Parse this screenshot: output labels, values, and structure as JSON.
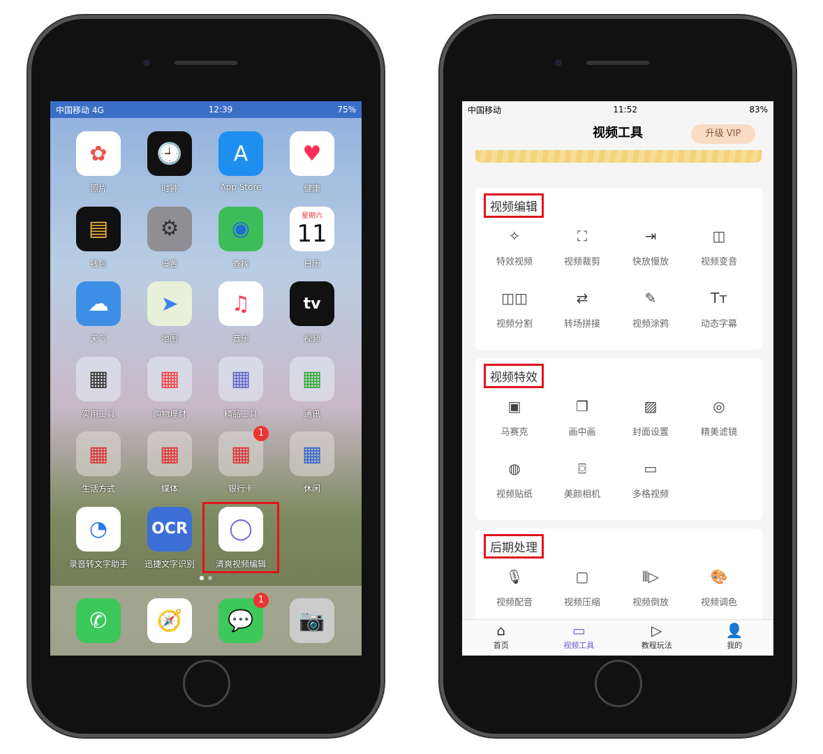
{
  "left_phone": {
    "status": {
      "carrier": "中国移动 4G",
      "time": "12:39",
      "battery": "75%"
    },
    "apps": [
      {
        "label": "照片",
        "icon": "✿",
        "bg": "#ffffff",
        "fg": "#e9574d"
      },
      {
        "label": "时钟",
        "icon": "🕘",
        "bg": "#111111",
        "fg": "#fff"
      },
      {
        "label": "App Store",
        "icon": "A",
        "bg": "#1f8ef1",
        "fg": "#fff"
      },
      {
        "label": "健康",
        "icon": "♥",
        "bg": "#ffffff",
        "fg": "#ff2d55"
      },
      {
        "label": "钱包",
        "icon": "▤",
        "bg": "#111111",
        "fg": "#f2b43c"
      },
      {
        "label": "设置",
        "icon": "⚙",
        "bg": "#8e8e93",
        "fg": "#333"
      },
      {
        "label": "查找",
        "icon": "◉",
        "bg": "#3dbd5a",
        "fg": "#1e6cd6"
      },
      {
        "label": "日历",
        "icon": "11",
        "bg": "#ffffff",
        "fg": "#111",
        "sub": "星期六"
      },
      {
        "label": "天气",
        "icon": "☁",
        "bg": "#3d8fe6",
        "fg": "#fff"
      },
      {
        "label": "地图",
        "icon": "➤",
        "bg": "#e8f0d8",
        "fg": "#3b82f6"
      },
      {
        "label": "音乐",
        "icon": "♫",
        "bg": "#ffffff",
        "fg": "#fa3c5a"
      },
      {
        "label": "视频",
        "icon": "tv",
        "bg": "#111111",
        "fg": "#fff"
      },
      {
        "label": "实用工具",
        "icon": "▦",
        "bg": "rgba(230,235,245,0.6)",
        "fg": "#333"
      },
      {
        "label": "购物理财",
        "icon": "▦",
        "bg": "rgba(230,235,245,0.6)",
        "fg": "#e44"
      },
      {
        "label": "精品工具",
        "icon": "▦",
        "bg": "rgba(230,235,245,0.6)",
        "fg": "#66c"
      },
      {
        "label": "通讯",
        "icon": "▦",
        "bg": "rgba(230,235,245,0.6)",
        "fg": "#3a3"
      },
      {
        "label": "生活方式",
        "icon": "▦",
        "bg": "rgba(220,215,210,0.6)",
        "fg": "#d33"
      },
      {
        "label": "媒体",
        "icon": "▦",
        "bg": "rgba(220,215,210,0.6)",
        "fg": "#d33"
      },
      {
        "label": "银行卡",
        "icon": "▦",
        "bg": "rgba(220,215,210,0.6)",
        "fg": "#d33",
        "badge": "1"
      },
      {
        "label": "休闲",
        "icon": "▦",
        "bg": "rgba(220,215,210,0.6)",
        "fg": "#36c"
      },
      {
        "label": "录音转文字助手",
        "icon": "◔",
        "bg": "#ffffff",
        "fg": "#2a7be6"
      },
      {
        "label": "迅捷文字识别",
        "icon": "OCR",
        "bg": "#3b6fd6",
        "fg": "#fff"
      },
      {
        "label": "清爽视频编辑",
        "icon": "◯",
        "bg": "#ffffff",
        "fg": "#7b5ce6"
      }
    ],
    "dock": [
      {
        "name": "phone",
        "icon": "✆",
        "bg": "#3cc85a",
        "fg": "#fff"
      },
      {
        "name": "safari",
        "icon": "🧭",
        "bg": "#ffffff",
        "fg": "#1e7ae6"
      },
      {
        "name": "messages",
        "icon": "💬",
        "bg": "#3cc85a",
        "fg": "#fff",
        "badge": "1"
      },
      {
        "name": "camera",
        "icon": "📷",
        "bg": "#cccccc",
        "fg": "#222"
      }
    ]
  },
  "right_phone": {
    "status": {
      "carrier": "中国移动",
      "time": "11:52",
      "battery": "83%"
    },
    "title": "视频工具",
    "vip_label": "升级 VIP",
    "sections": [
      {
        "title": "视频编辑",
        "tools": [
          {
            "label": "特效视频",
            "icon": "✧"
          },
          {
            "label": "视频裁剪",
            "icon": "⛶"
          },
          {
            "label": "快放慢放",
            "icon": "⇥"
          },
          {
            "label": "视频变音",
            "icon": "◫"
          },
          {
            "label": "视频分割",
            "icon": "◫◫"
          },
          {
            "label": "转场拼接",
            "icon": "⇄"
          },
          {
            "label": "视频涂鸦",
            "icon": "✎"
          },
          {
            "label": "动态字幕",
            "icon": "Tт"
          }
        ]
      },
      {
        "title": "视频特效",
        "tools": [
          {
            "label": "马赛克",
            "icon": "▣"
          },
          {
            "label": "画中画",
            "icon": "❐"
          },
          {
            "label": "封面设置",
            "icon": "▨"
          },
          {
            "label": "精美滤镜",
            "icon": "◎"
          },
          {
            "label": "视频贴纸",
            "icon": "◍"
          },
          {
            "label": "美颜相机",
            "icon": "⌼"
          },
          {
            "label": "多格视频",
            "icon": "▭"
          }
        ]
      },
      {
        "title": "后期处理",
        "tools": [
          {
            "label": "视频配音",
            "icon": "🎙"
          },
          {
            "label": "视频压缩",
            "icon": "▢"
          },
          {
            "label": "视频倒放",
            "icon": "⫴▷"
          },
          {
            "label": "视频调色",
            "icon": "🎨"
          }
        ]
      }
    ],
    "tabs": [
      {
        "label": "首页",
        "icon": "⌂"
      },
      {
        "label": "视频工具",
        "icon": "▭",
        "active": true
      },
      {
        "label": "教程玩法",
        "icon": "▷"
      },
      {
        "label": "我的",
        "icon": "👤"
      }
    ],
    "accent": "#6a5acd"
  }
}
